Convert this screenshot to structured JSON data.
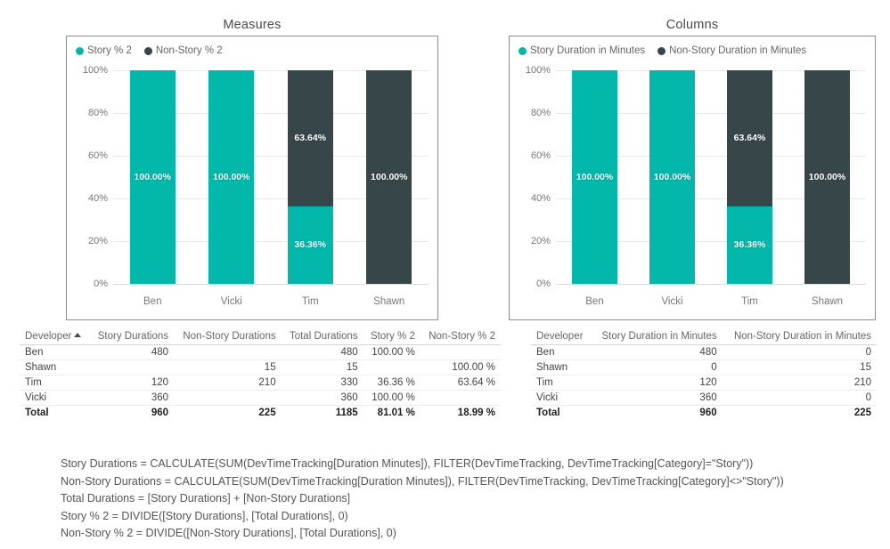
{
  "charts": [
    {
      "title": "Measures",
      "legend": [
        {
          "label": "Story % 2",
          "color": "#01b8aa",
          "icon": "legend-dot-story"
        },
        {
          "label": "Non-Story % 2",
          "color": "#374649",
          "icon": "legend-dot-non-story"
        }
      ],
      "chart_data": {
        "type": "bar",
        "stacked": true,
        "normalized": true,
        "title": "Measures",
        "xlabel": "",
        "ylabel": "",
        "ylim": [
          0,
          100
        ],
        "yticks": [
          "0%",
          "20%",
          "40%",
          "60%",
          "80%",
          "100%"
        ],
        "grid": true,
        "legend_position": "top-left",
        "categories": [
          "Ben",
          "Vicki",
          "Tim",
          "Shawn"
        ],
        "series": [
          {
            "name": "Story % 2",
            "color": "#01b8aa",
            "values": [
              100.0,
              100.0,
              36.36,
              0.0
            ],
            "labels": [
              "100.00%",
              "100.00%",
              "36.36%",
              ""
            ]
          },
          {
            "name": "Non-Story % 2",
            "color": "#374649",
            "values": [
              0.0,
              0.0,
              63.64,
              100.0
            ],
            "labels": [
              "",
              "",
              "63.64%",
              "100.00%"
            ]
          }
        ]
      }
    },
    {
      "title": "Columns",
      "legend": [
        {
          "label": "Story Duration in Minutes",
          "color": "#01b8aa",
          "icon": "legend-dot-story"
        },
        {
          "label": "Non-Story Duration in Minutes",
          "color": "#374649",
          "icon": "legend-dot-non-story"
        }
      ],
      "chart_data": {
        "type": "bar",
        "stacked": true,
        "normalized": true,
        "title": "Columns",
        "xlabel": "",
        "ylabel": "",
        "ylim": [
          0,
          100
        ],
        "yticks": [
          "0%",
          "20%",
          "40%",
          "60%",
          "80%",
          "100%"
        ],
        "grid": true,
        "legend_position": "top-left",
        "categories": [
          "Ben",
          "Vicki",
          "Tim",
          "Shawn"
        ],
        "series": [
          {
            "name": "Story Duration in Minutes",
            "color": "#01b8aa",
            "values": [
              100.0,
              100.0,
              36.36,
              0.0
            ],
            "labels": [
              "100.00%",
              "100.00%",
              "36.36%",
              ""
            ]
          },
          {
            "name": "Non-Story Duration in Minutes",
            "color": "#374649",
            "values": [
              0.0,
              0.0,
              63.64,
              100.0
            ],
            "labels": [
              "",
              "",
              "63.64%",
              "100.00%"
            ]
          }
        ]
      }
    }
  ],
  "tables": [
    {
      "name": "measures-table",
      "sorted_column": "Developer",
      "sort_direction": "asc",
      "columns": [
        {
          "label": "Developer",
          "align": "left",
          "sorted": true
        },
        {
          "label": "Story Durations",
          "align": "right",
          "sorted": false
        },
        {
          "label": "Non-Story Durations",
          "align": "right",
          "sorted": false
        },
        {
          "label": "Total Durations",
          "align": "right",
          "sorted": false
        },
        {
          "label": "Story % 2",
          "align": "right",
          "sorted": false
        },
        {
          "label": "Non-Story % 2",
          "align": "right",
          "sorted": false
        }
      ],
      "rows": [
        [
          "Ben",
          "480",
          "",
          "480",
          "100.00 %",
          ""
        ],
        [
          "Shawn",
          "",
          "15",
          "15",
          "",
          "100.00 %"
        ],
        [
          "Tim",
          "120",
          "210",
          "330",
          "36.36 %",
          "63.64 %"
        ],
        [
          "Vicki",
          "360",
          "",
          "360",
          "100.00 %",
          ""
        ]
      ],
      "total": [
        "Total",
        "960",
        "225",
        "1185",
        "81.01 %",
        "18.99 %"
      ]
    },
    {
      "name": "columns-table",
      "sorted_column": "",
      "sort_direction": "",
      "columns": [
        {
          "label": "Developer",
          "align": "left",
          "sorted": false
        },
        {
          "label": "Story Duration in Minutes",
          "align": "right",
          "sorted": false
        },
        {
          "label": "Non-Story Duration in Minutes",
          "align": "right",
          "sorted": false
        }
      ],
      "rows": [
        [
          "Ben",
          "480",
          "0"
        ],
        [
          "Shawn",
          "0",
          "15"
        ],
        [
          "Tim",
          "120",
          "210"
        ],
        [
          "Vicki",
          "360",
          "0"
        ]
      ],
      "total": [
        "Total",
        "960",
        "225"
      ]
    }
  ],
  "formulas": [
    "Story Durations = CALCULATE(SUM(DevTimeTracking[Duration Minutes]), FILTER(DevTimeTracking, DevTimeTracking[Category]=\"Story\"))",
    "Non-Story Durations = CALCULATE(SUM(DevTimeTracking[Duration Minutes]), FILTER(DevTimeTracking, DevTimeTracking[Category]<>\"Story\"))",
    "Total Durations = [Story Durations] + [Non-Story Durations]",
    "Story % 2 = DIVIDE([Story Durations], [Total Durations], 0)",
    "Non-Story % 2 = DIVIDE([Non-Story Durations], [Total Durations], 0)"
  ],
  "colors": {
    "story": "#01b8aa",
    "non_story": "#374649",
    "grid": "#e8e8e8",
    "axis_text": "#777777",
    "border": "#8c8c8c"
  }
}
